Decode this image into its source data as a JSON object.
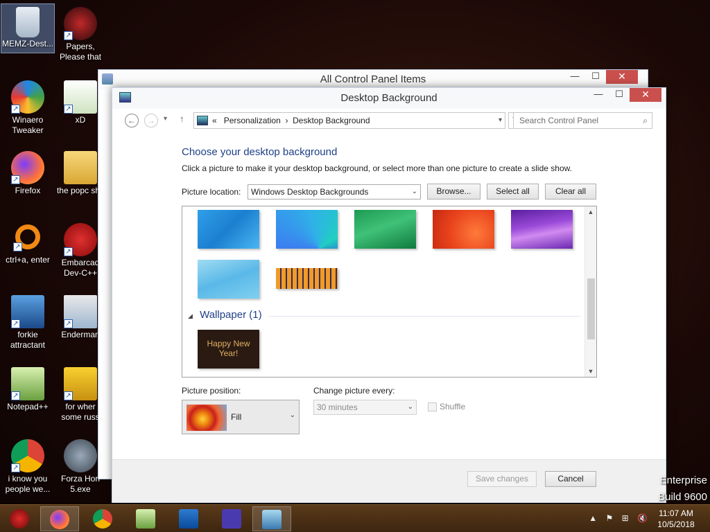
{
  "desktop_icons": [
    {
      "label": "MEMZ-Dest...",
      "icon": "recycle-bin-icon",
      "selected": true
    },
    {
      "label": "Papers, Please that but when its c#",
      "icon": "papers-please-icon"
    },
    {
      "label": "Winaero Tweaker",
      "icon": "winaero-icon"
    },
    {
      "label": "xD",
      "icon": "hxd-icon"
    },
    {
      "label": "Firefox",
      "icon": "firefox-icon"
    },
    {
      "label": "the popc shit",
      "icon": "folder-icon"
    },
    {
      "label": "ctrl+a, enter",
      "icon": "ring-icon"
    },
    {
      "label": "Embarcad Dev-C++",
      "icon": "dev-cpp-icon"
    },
    {
      "label": "forkie attractant",
      "icon": "gear-screen-icon"
    },
    {
      "label": "Enderman",
      "icon": "window-icon"
    },
    {
      "label": "Notepad++",
      "icon": "notepad-plus-icon"
    },
    {
      "label": "for wher some russ",
      "icon": "dos-icon"
    },
    {
      "label": "i know you people we...",
      "icon": "chrome-icon"
    },
    {
      "label": "Forza Hori 5.exe",
      "icon": "flash-icon"
    }
  ],
  "back_window": {
    "title": "All Control Panel Items"
  },
  "window": {
    "title": "Desktop Background",
    "caption": {
      "minimize": "—",
      "maximize": "☐",
      "close": "✕"
    }
  },
  "nav": {
    "back": "←",
    "forward": "→",
    "recent": "▾",
    "up": "↑",
    "breadcrumb_prefix": "«",
    "breadcrumb": [
      "Personalization",
      "Desktop Background"
    ],
    "separator": "›",
    "address_dropdown": "▾",
    "refresh": "↻",
    "search_placeholder": "Search Control Panel",
    "search_icon": "⌕"
  },
  "main": {
    "heading": "Choose your desktop background",
    "subtitle": "Click a picture to make it your desktop background, or select more than one picture to create a slide show.",
    "picture_location_label": "Picture location:",
    "picture_location_value": "Windows Desktop Backgrounds",
    "dropdown_arrow": "⌄",
    "browse_button": "Browse...",
    "select_all_button": "Select all",
    "clear_all_button": "Clear all",
    "group_triangle": "◢",
    "group_wallpaper": "Wallpaper (1)",
    "wallpaper_thumb_text": "Happy New Year!",
    "scroll_up": "▲",
    "scroll_down": "▼"
  },
  "options": {
    "picture_position_label": "Picture position:",
    "picture_position_value": "Fill",
    "change_picture_label": "Change picture every:",
    "change_picture_value": "30 minutes",
    "shuffle_label": "Shuffle"
  },
  "footer": {
    "save_button": "Save changes",
    "cancel_button": "Cancel"
  },
  "taskbar": {
    "tray_items": [
      "▲",
      "⚑",
      "⊞",
      "🔇"
    ],
    "time": "11:07 AM",
    "date": "10/5/2018"
  },
  "watermark": {
    "line1": "Enterprise",
    "line2": "Build 9600"
  }
}
